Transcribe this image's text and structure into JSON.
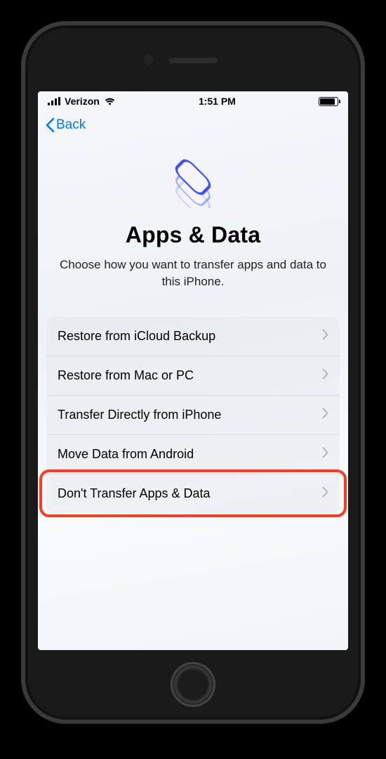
{
  "status": {
    "carrier": "Verizon",
    "time": "1:51 PM"
  },
  "nav": {
    "back_label": "Back"
  },
  "hero": {
    "title": "Apps & Data",
    "subtitle": "Choose how you want to transfer apps and data to this iPhone."
  },
  "options": [
    "Restore from iCloud Backup",
    "Restore from Mac or PC",
    "Transfer Directly from iPhone",
    "Move Data from Android",
    "Don't Transfer Apps & Data"
  ],
  "highlight_index": 4,
  "colors": {
    "accent": "#007aff",
    "highlight": "#ff3b1f"
  }
}
